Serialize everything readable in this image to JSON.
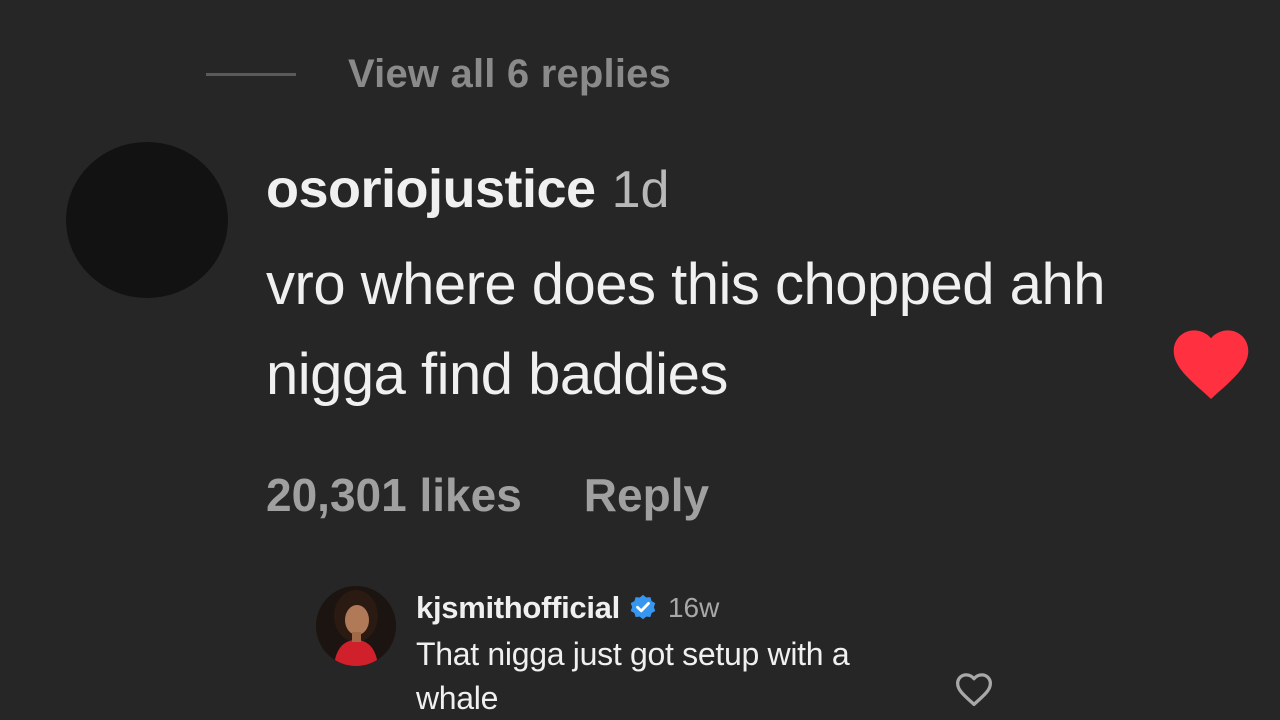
{
  "thread": {
    "view_replies_label": "View all 6 replies"
  },
  "comment": {
    "username": "osoriojustice",
    "time": "1d",
    "text": "vro where does this chopped ahh nigga find baddies",
    "likes": "20,301 likes",
    "reply_label": "Reply",
    "liked": true,
    "heart_color": "#ff3040"
  },
  "reply": {
    "username": "kjsmithofficial",
    "verified": true,
    "verified_color": "#3797f0",
    "time": "16w",
    "text": "That nigga just got setup with a whale",
    "liked": false
  },
  "icons": {
    "comment_heart": "heart-filled-icon",
    "reply_heart": "heart-outline-icon",
    "verified": "verified-badge-icon"
  }
}
